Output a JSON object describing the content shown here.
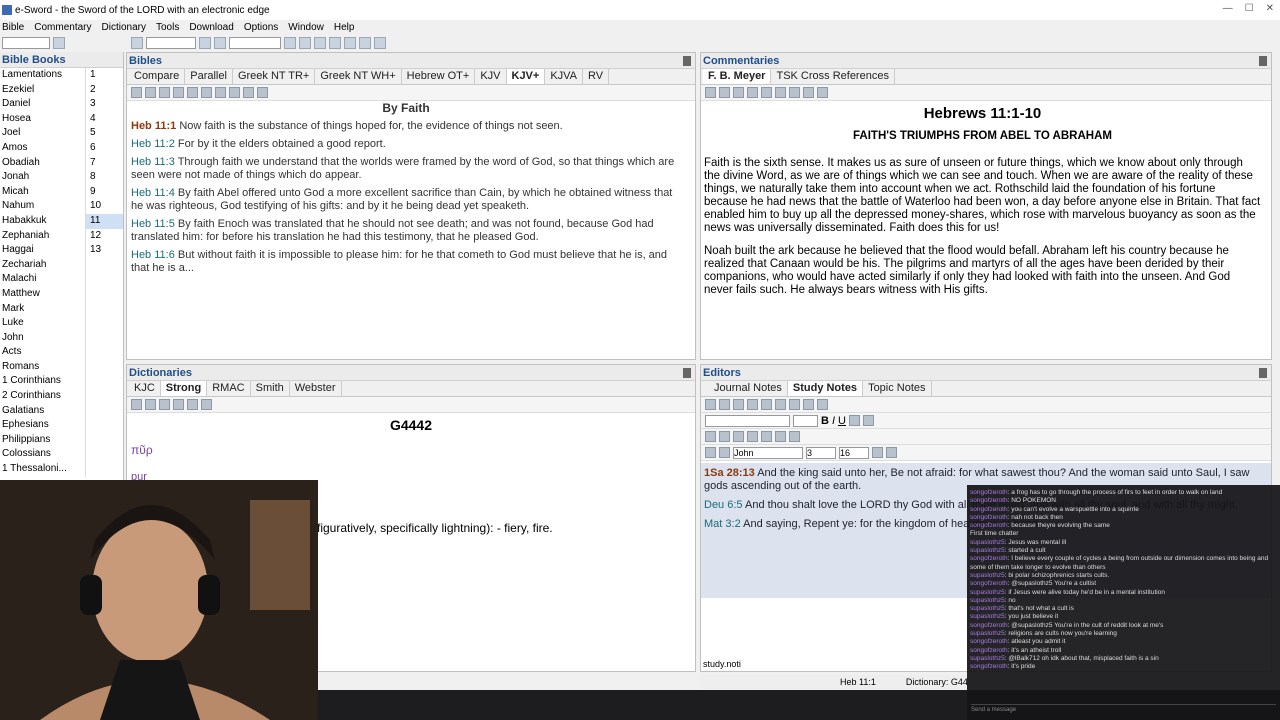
{
  "app": {
    "title": "e-Sword - the Sword of the LORD with an electronic edge"
  },
  "menu": [
    "Bible",
    "Commentary",
    "Dictionary",
    "Tools",
    "Download",
    "Options",
    "Window",
    "Help"
  ],
  "books": {
    "header": "Bible Books",
    "items": [
      "Lamentations",
      "Ezekiel",
      "Daniel",
      "Hosea",
      "Joel",
      "Amos",
      "Obadiah",
      "Jonah",
      "Micah",
      "Nahum",
      "Habakkuk",
      "Zephaniah",
      "Haggai",
      "Zechariah",
      "Malachi",
      "Matthew",
      "Mark",
      "Luke",
      "John",
      "Acts",
      "Romans",
      "1 Corinthians",
      "2 Corinthians",
      "Galatians",
      "Ephesians",
      "Philippians",
      "Colossians",
      "1 Thessaloni..."
    ],
    "chapters": [
      "1",
      "2",
      "3",
      "4",
      "5",
      "6",
      "7",
      "8",
      "9",
      "10",
      "11",
      "12",
      "13"
    ],
    "selected_chapter": "11"
  },
  "bibles": {
    "header": "Bibles",
    "tabs": [
      "Compare",
      "Parallel",
      "Greek NT TR+",
      "Greek NT WH+",
      "Hebrew OT+",
      "KJV",
      "KJV+",
      "KJVA",
      "RV"
    ],
    "active_tab": "KJV+",
    "heading": "By Faith",
    "verses": [
      {
        "ref": "Heb 11:1",
        "text": "Now faith is the substance of things hoped for, the evidence of things not seen."
      },
      {
        "ref": "Heb 11:2",
        "text": "For by it the elders obtained a good report."
      },
      {
        "ref": "Heb 11:3",
        "text": "Through faith we understand that the worlds were framed by the word of God, so that things which are seen were not made of things which do appear."
      },
      {
        "ref": "Heb 11:4",
        "text": "By faith Abel offered unto God a more excellent sacrifice than Cain, by which he obtained witness that he was righteous, God testifying of his gifts: and by it he being dead yet speaketh."
      },
      {
        "ref": "Heb 11:5",
        "text": "By faith Enoch was translated that he should not see death; and was not found, because God had translated him: for before his translation he had this testimony, that he pleased God."
      },
      {
        "ref": "Heb 11:6",
        "text": "But without faith it is impossible to please him: for he that cometh to God must believe that he is, and that he is a..."
      }
    ]
  },
  "commentaries": {
    "header": "Commentaries",
    "tabs": [
      "F. B. Meyer",
      "TSK Cross References"
    ],
    "active_tab": "F. B. Meyer",
    "title": "Hebrews 11:1-10",
    "subtitle": "FAITH'S TRIUMPHS FROM ABEL TO ABRAHAM",
    "paragraphs": [
      "Faith is the sixth sense. It makes us as sure of unseen or future things, which we know about only through the divine Word, as we are of things which we can see and touch. When we are aware of the reality of these things, we naturally take them into account when we act. Rothschild laid the foundation of his fortune because he had news that the battle of Waterloo had been won, a day before anyone else in Britain. That fact enabled him to buy up all the depressed money-shares, which rose with marvelous buoyancy as soon as the news was universally disseminated. Faith does this for us!",
      "Noah built the ark because he believed that the flood would befall. Abraham left his country because he realized that Canaan would be his. The pilgrims and martyrs of all the ages have been derided by their companions, who would have acted similarly if only they had looked with faith into the unseen. And God never fails such. He always bears witness with His gifts."
    ]
  },
  "dictionaries": {
    "header": "Dictionaries",
    "tabs": [
      "KJC",
      "Strong",
      "RMAC",
      "Smith",
      "Webster"
    ],
    "active_tab": "Strong",
    "entry": "G4442",
    "greek": "πῦρ",
    "translit": "pur",
    "definition": "figuratively, specifically lightning): - fiery, fire."
  },
  "editors": {
    "header": "Editors",
    "tabs": [
      "Journal Notes",
      "Study Notes",
      "Topic Notes"
    ],
    "active_tab": "Study Notes",
    "font": "John",
    "size_a": "3",
    "size_b": "16",
    "notes": [
      {
        "ref": "1Sa 28:13",
        "text": "And the king said unto her, Be not afraid: for what sawest thou? And the woman said unto Saul, I saw gods ascending out of the earth."
      },
      {
        "ref": "Deu 6:5",
        "text": "And thou shalt love the LORD thy God with all thine heart, and with all thy soul, and with all thy might."
      },
      {
        "ref": "Mat 3:2",
        "text": "And saying, Repent ye: for the kingdom of heaven is at hand."
      }
    ],
    "file": "study.noti"
  },
  "status": {
    "verse": "Heb 11:1",
    "dictionary": "Dictionary: G44"
  },
  "chat": [
    {
      "u": "songofzeroth",
      "m": "a frog has to go through the process of firs to feet in order to walk on land"
    },
    {
      "u": "songofzeroth",
      "m": "NO POKEMON"
    },
    {
      "u": "songofzeroth",
      "m": "you can't evolve a warspuettle into a squirrle"
    },
    {
      "u": "songofzeroth",
      "m": "nah not back then"
    },
    {
      "u": "songofzeroth",
      "m": "because theyre evolving the same"
    },
    {
      "u": "",
      "m": "First time chatter"
    },
    {
      "u": "supaslothz5",
      "m": "Jesus was mental ill"
    },
    {
      "u": "supaslothz5",
      "m": "started a cult"
    },
    {
      "u": "songofzeroth",
      "m": "I believe every couple of cycles a being from outside our dimension comes into being and some of them take longer to evolve than others"
    },
    {
      "u": "supaslothz5",
      "m": "bi polar schizophrenics starts cults."
    },
    {
      "u": "songofzeroth",
      "m": "@supaslothz5 You're a cultist"
    },
    {
      "u": "supaslothz5",
      "m": "if Jesus were alive today he'd be in a mental institution"
    },
    {
      "u": "supaslothz5",
      "m": "no"
    },
    {
      "u": "supaslothz5",
      "m": "that's not what a cult is"
    },
    {
      "u": "supaslothz5",
      "m": "you just believe it"
    },
    {
      "u": "songofzeroth",
      "m": "@supaslothz5 You're in the cult of reddit look at me's"
    },
    {
      "u": "supaslothz5",
      "m": "religions are cults now you're learning"
    },
    {
      "u": "songofzeroth",
      "m": "atleast you admit it"
    },
    {
      "u": "songofzeroth",
      "m": "it's an atheist troll"
    },
    {
      "u": "supaslothz5",
      "m": "@lBalk712 oh idk about that, misplaced faith is a sin"
    },
    {
      "u": "songofzeroth",
      "m": "it's pride"
    }
  ],
  "chat_input_placeholder": "Send a message"
}
